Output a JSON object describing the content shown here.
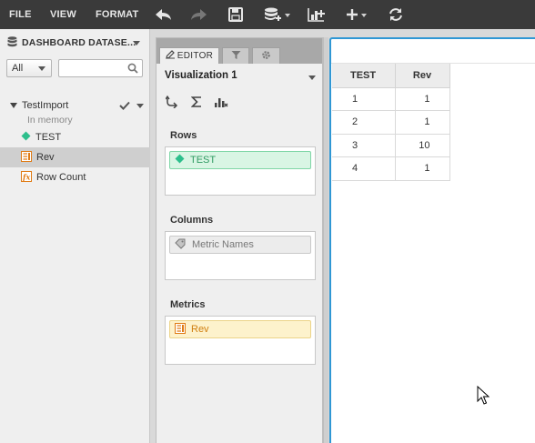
{
  "menubar": {
    "file": "FILE",
    "view": "VIEW",
    "format": "FORMAT"
  },
  "toolbar_icons": [
    "undo-icon",
    "redo-icon",
    "save-icon",
    "add-data-icon",
    "insert-visualization-icon",
    "add-icon",
    "refresh-icon"
  ],
  "dataset_panel": {
    "title": "DASHBOARD DATASE...",
    "filter_value": "All",
    "search_value": "",
    "dataset": {
      "name": "TestImport",
      "subtitle": "In memory"
    },
    "items": [
      {
        "label": "TEST",
        "type": "attribute",
        "selected": false
      },
      {
        "label": "Rev",
        "type": "metric",
        "selected": true
      },
      {
        "label": "Row Count",
        "type": "derived-metric",
        "selected": false
      }
    ]
  },
  "editor": {
    "tabs": [
      {
        "label": "EDITOR",
        "active": true
      },
      {
        "label": "",
        "icon": "filter-icon",
        "active": false
      },
      {
        "label": "",
        "icon": "gear-icon",
        "active": false
      }
    ],
    "visualization_title": "Visualization 1",
    "zones": {
      "rows": {
        "label": "Rows",
        "items": [
          "TEST"
        ]
      },
      "columns": {
        "label": "Columns",
        "items": [
          "Metric Names"
        ]
      },
      "metrics": {
        "label": "Metrics",
        "items": [
          "Rev"
        ]
      }
    }
  },
  "grid": {
    "headers": [
      "TEST",
      "Rev"
    ],
    "rows": [
      [
        "1",
        "1"
      ],
      [
        "2",
        "1"
      ],
      [
        "3",
        "10"
      ],
      [
        "4",
        "1"
      ]
    ]
  },
  "colors": {
    "toolbar_bg": "#3a3a3a",
    "accent_border": "#2f97d4",
    "attribute_green": "#2dbf8c",
    "metric_orange": "#e07b14"
  }
}
